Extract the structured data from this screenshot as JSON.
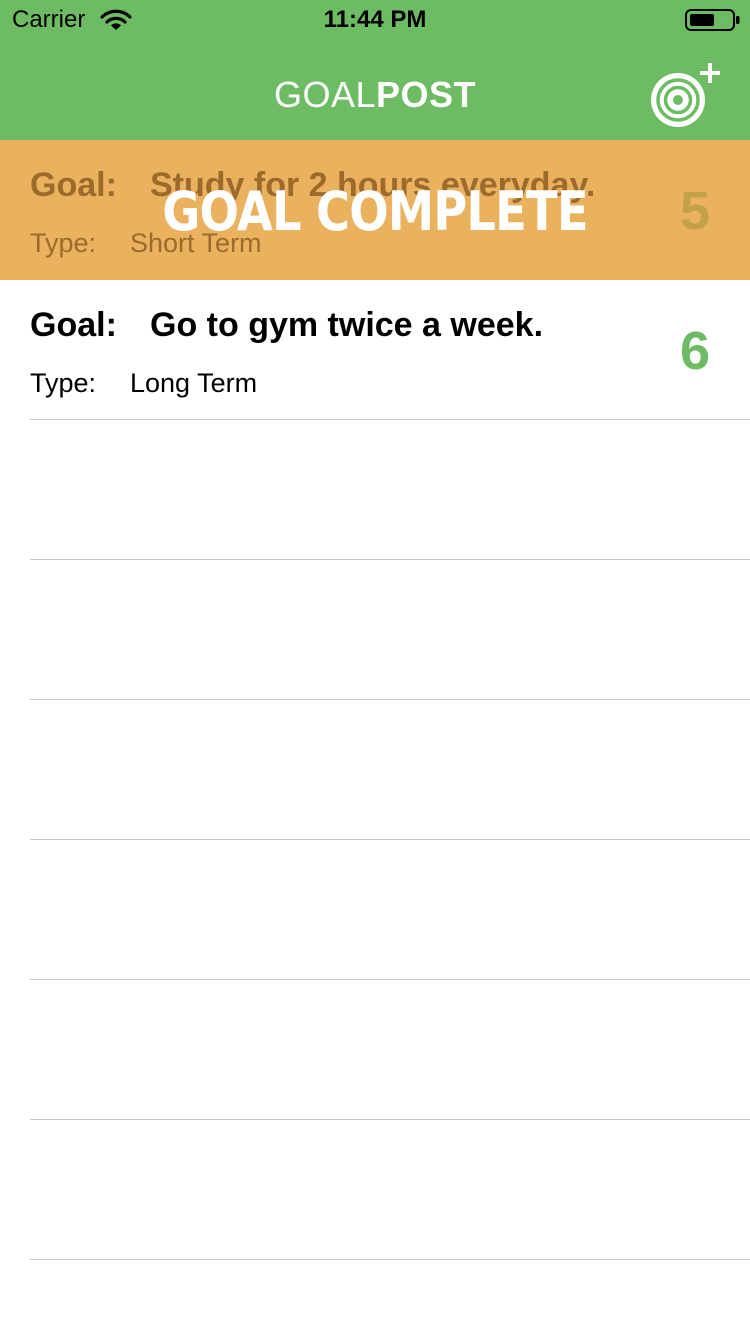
{
  "status_bar": {
    "carrier": "Carrier",
    "time": "11:44 PM",
    "wifi_icon": "wifi-icon",
    "battery_icon": "battery-icon"
  },
  "nav": {
    "title_light": "GOAL",
    "title_bold": "POST",
    "add_button_icon": "target-plus-icon"
  },
  "colors": {
    "nav_green": "#6dbc63",
    "complete_orange": "#eab15f"
  },
  "goals": [
    {
      "goal_label": "Goal:",
      "goal": "Study for 2 hours everyday.",
      "type_label": "Type:",
      "type": "Short Term",
      "count": "5",
      "completed": true,
      "completed_text": "GOAL COMPLETE"
    },
    {
      "goal_label": "Goal:",
      "goal": "Go to gym twice a week.",
      "type_label": "Type:",
      "type": "Long Term",
      "count": "6",
      "completed": false
    }
  ]
}
